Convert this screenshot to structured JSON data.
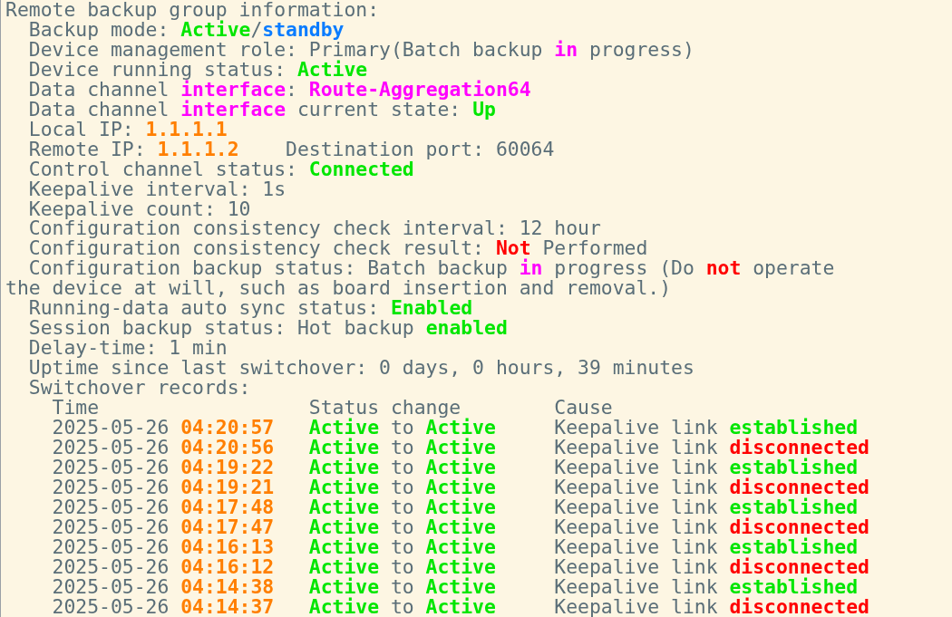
{
  "title": "Remote backup group information:",
  "lines": [
    {
      "kind": "line",
      "segments": [
        {
          "text": "Backup mode: "
        },
        {
          "text": "Active",
          "color": "#00e600"
        },
        {
          "text": "/"
        },
        {
          "text": "standby",
          "color": "#0a7cff"
        }
      ]
    },
    {
      "kind": "line",
      "segments": [
        {
          "text": "Device management role: Primary(Batch backup "
        },
        {
          "text": "in",
          "color": "#ff00ff"
        },
        {
          "text": " progress)"
        }
      ]
    },
    {
      "kind": "line",
      "segments": [
        {
          "text": "Device running status: "
        },
        {
          "text": "Active",
          "color": "#00e600"
        }
      ]
    },
    {
      "kind": "line",
      "segments": [
        {
          "text": "Data channel "
        },
        {
          "text": "interface",
          "color": "#ff00ff"
        },
        {
          "text": ": "
        },
        {
          "text": "Route-Aggregation64",
          "color": "#ff00ff"
        }
      ]
    },
    {
      "kind": "line",
      "segments": [
        {
          "text": "Data channel "
        },
        {
          "text": "interface",
          "color": "#ff00ff"
        },
        {
          "text": " current state: "
        },
        {
          "text": "Up",
          "color": "#00e600"
        }
      ]
    },
    {
      "kind": "line",
      "segments": [
        {
          "text": "Local IP: "
        },
        {
          "text": "1.1.1.1",
          "color": "#ff7f00"
        }
      ]
    },
    {
      "kind": "pair",
      "segments": [
        {
          "text": "Remote IP: "
        },
        {
          "text": "1.1.1.2",
          "color": "#ff7f00"
        }
      ],
      "extra": "Destination port: 60064"
    },
    {
      "kind": "line",
      "segments": [
        {
          "text": "Control channel status: "
        },
        {
          "text": "Connected",
          "color": "#00e600"
        }
      ]
    },
    {
      "kind": "line",
      "segments": [
        {
          "text": "Keepalive interval: 1s"
        }
      ]
    },
    {
      "kind": "line",
      "segments": [
        {
          "text": "Keepalive count: 10"
        }
      ]
    },
    {
      "kind": "line",
      "segments": [
        {
          "text": "Configuration consistency check interval: 12 hour"
        }
      ]
    },
    {
      "kind": "line",
      "segments": [
        {
          "text": "Configuration consistency check result: "
        },
        {
          "text": "Not",
          "color": "#ff0000"
        },
        {
          "text": " Performed"
        }
      ]
    },
    {
      "kind": "line",
      "segments": [
        {
          "text": "Configuration backup status: Batch backup "
        },
        {
          "text": "in",
          "color": "#ff00ff"
        },
        {
          "text": " progress (Do "
        },
        {
          "text": "not",
          "color": "#ff0000"
        },
        {
          "text": " operate"
        }
      ]
    },
    {
      "kind": "continuation",
      "segments": [
        {
          "text": "the device at will, such as board insertion and removal.)"
        }
      ]
    },
    {
      "kind": "line",
      "segments": [
        {
          "text": "Running-data auto sync status: "
        },
        {
          "text": "Enabled",
          "color": "#00e600"
        }
      ]
    },
    {
      "kind": "line",
      "segments": [
        {
          "text": "Session backup status: Hot backup "
        },
        {
          "text": "enabled",
          "color": "#00e600"
        }
      ]
    },
    {
      "kind": "line",
      "segments": [
        {
          "text": "Delay-time: 1 min"
        }
      ]
    },
    {
      "kind": "line",
      "segments": [
        {
          "text": "Uptime since last switchover: 0 days, 0 hours, 39 minutes"
        }
      ]
    },
    {
      "kind": "line",
      "segments": [
        {
          "text": "Switchover records:"
        }
      ]
    }
  ],
  "records": {
    "columns": [
      "Time",
      "Status change",
      "Cause"
    ],
    "rows": [
      {
        "date": "2025-05-26",
        "time": "04:20:57",
        "from": "Active",
        "to_word": "to",
        "to": "Active",
        "cause": "Keepalive link",
        "event": "established",
        "color": "#00e600"
      },
      {
        "date": "2025-05-26",
        "time": "04:20:56",
        "from": "Active",
        "to_word": "to",
        "to": "Active",
        "cause": "Keepalive link",
        "event": "disconnected",
        "color": "#ff0000"
      },
      {
        "date": "2025-05-26",
        "time": "04:19:22",
        "from": "Active",
        "to_word": "to",
        "to": "Active",
        "cause": "Keepalive link",
        "event": "established",
        "color": "#00e600"
      },
      {
        "date": "2025-05-26",
        "time": "04:19:21",
        "from": "Active",
        "to_word": "to",
        "to": "Active",
        "cause": "Keepalive link",
        "event": "disconnected",
        "color": "#ff0000"
      },
      {
        "date": "2025-05-26",
        "time": "04:17:48",
        "from": "Active",
        "to_word": "to",
        "to": "Active",
        "cause": "Keepalive link",
        "event": "established",
        "color": "#00e600"
      },
      {
        "date": "2025-05-26",
        "time": "04:17:47",
        "from": "Active",
        "to_word": "to",
        "to": "Active",
        "cause": "Keepalive link",
        "event": "disconnected",
        "color": "#ff0000"
      },
      {
        "date": "2025-05-26",
        "time": "04:16:13",
        "from": "Active",
        "to_word": "to",
        "to": "Active",
        "cause": "Keepalive link",
        "event": "established",
        "color": "#00e600"
      },
      {
        "date": "2025-05-26",
        "time": "04:16:12",
        "from": "Active",
        "to_word": "to",
        "to": "Active",
        "cause": "Keepalive link",
        "event": "disconnected",
        "color": "#ff0000"
      },
      {
        "date": "2025-05-26",
        "time": "04:14:38",
        "from": "Active",
        "to_word": "to",
        "to": "Active",
        "cause": "Keepalive link",
        "event": "established",
        "color": "#00e600"
      },
      {
        "date": "2025-05-26",
        "time": "04:14:37",
        "from": "Active",
        "to_word": "to",
        "to": "Active",
        "cause": "Keepalive link",
        "event": "disconnected",
        "color": "#ff0000"
      }
    ]
  }
}
